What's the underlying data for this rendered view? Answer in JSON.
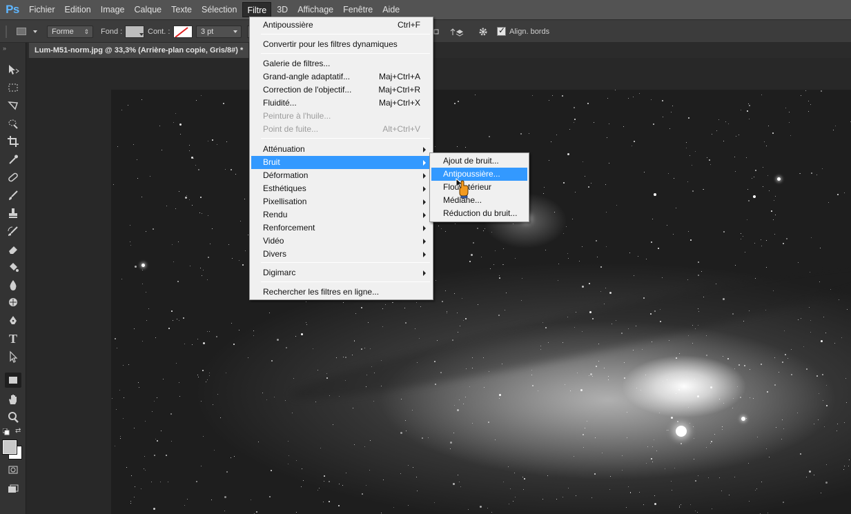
{
  "app": {
    "logo": "Ps"
  },
  "menubar": {
    "items": [
      "Fichier",
      "Edition",
      "Image",
      "Calque",
      "Texte",
      "Sélection",
      "Filtre",
      "3D",
      "Affichage",
      "Fenêtre",
      "Aide"
    ],
    "active": "Filtre"
  },
  "options": {
    "shape_mode": "Forme",
    "fill_label": "Fond :",
    "stroke_label": "Cont. :",
    "stroke_width": "3 pt",
    "align_edges_label": "Align. bords",
    "align_edges_checked": true
  },
  "document": {
    "tab_title": "Lum-M51-norm.jpg @ 33,3% (Arrière-plan copie, Gris/8#) *"
  },
  "filtre_menu": {
    "items": [
      {
        "label": "Antipoussière",
        "shortcut": "Ctrl+F"
      },
      {
        "label": "Convertir pour les filtres dynamiques"
      },
      {
        "label": "Galerie de filtres..."
      },
      {
        "label": "Grand-angle adaptatif...",
        "shortcut": "Maj+Ctrl+A"
      },
      {
        "label": "Correction de l'objectif...",
        "shortcut": "Maj+Ctrl+R"
      },
      {
        "label": "Fluidité...",
        "shortcut": "Maj+Ctrl+X"
      },
      {
        "label": "Peinture à l'huile...",
        "disabled": true
      },
      {
        "label": "Point de fuite...",
        "shortcut": "Alt+Ctrl+V",
        "disabled": true
      },
      {
        "label": "Atténuation",
        "submenu": true
      },
      {
        "label": "Bruit",
        "submenu": true,
        "highlighted": true
      },
      {
        "label": "Déformation",
        "submenu": true
      },
      {
        "label": "Esthétiques",
        "submenu": true
      },
      {
        "label": "Pixellisation",
        "submenu": true
      },
      {
        "label": "Rendu",
        "submenu": true
      },
      {
        "label": "Renforcement",
        "submenu": true
      },
      {
        "label": "Vidéo",
        "submenu": true
      },
      {
        "label": "Divers",
        "submenu": true
      },
      {
        "label": "Digimarc",
        "submenu": true
      },
      {
        "label": "Rechercher les filtres en ligne..."
      }
    ]
  },
  "bruit_menu": {
    "items": [
      {
        "label": "Ajout de bruit..."
      },
      {
        "label": "Antipoussière...",
        "highlighted": true
      },
      {
        "label": "Flou intérieur"
      },
      {
        "label": "Médiane..."
      },
      {
        "label": "Réduction du bruit..."
      }
    ]
  },
  "colors": {
    "menubar_bg": "#535353",
    "panel_bg": "#3c3c3c",
    "highlight": "#3399ff",
    "ps_logo": "#5fb6ff",
    "menu_bg": "#f0f0f0"
  },
  "icons": {
    "tools": [
      "move-icon",
      "marquee-icon",
      "lasso-icon",
      "quick-select-icon",
      "crop-icon",
      "eyedropper-icon",
      "healing-icon",
      "brush-icon",
      "clone-stamp-icon",
      "history-brush-icon",
      "eraser-icon",
      "paint-bucket-icon",
      "blur-icon",
      "dodge-icon",
      "pen-icon",
      "type-icon",
      "path-select-icon",
      "rectangle-icon",
      "hand-icon",
      "zoom-icon"
    ],
    "cursor": "hand-pointer-cursor"
  }
}
